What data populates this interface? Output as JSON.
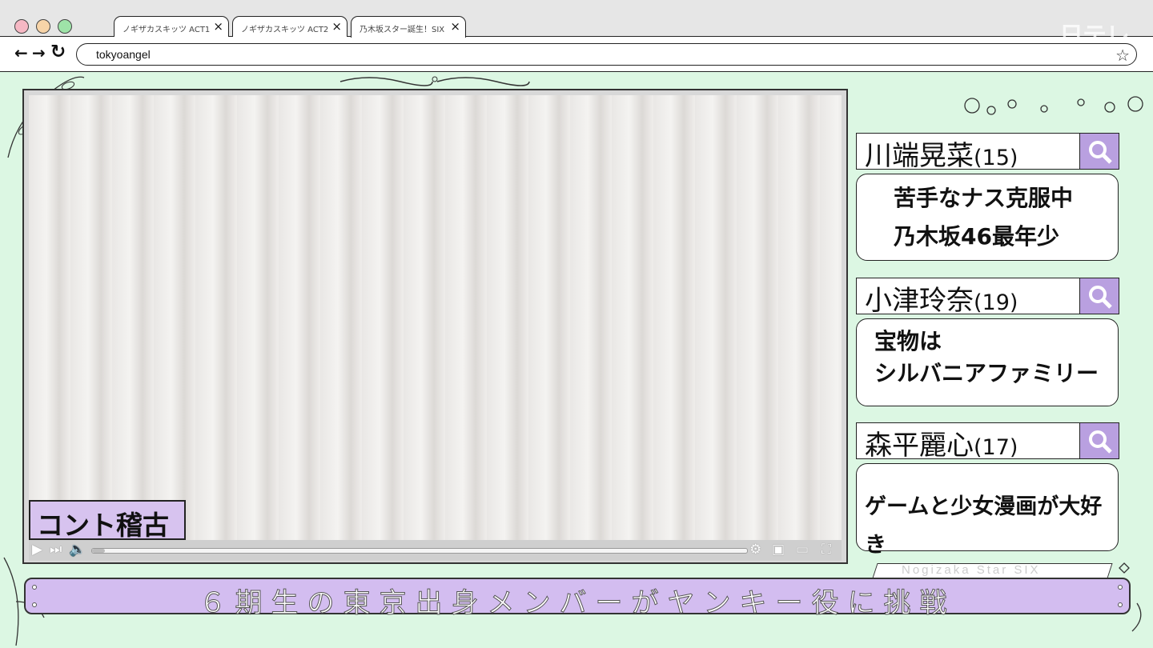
{
  "browser": {
    "tabs": [
      {
        "label": "ノギザカスキッツ ACT1"
      },
      {
        "label": "ノギザカスキッツ ACT2"
      },
      {
        "label": "乃木坂スター誕生！SIX"
      }
    ],
    "address": "tokyoangel",
    "watermark": "日テレ"
  },
  "video": {
    "caption": "コント稽古",
    "progress": 0.02
  },
  "members": [
    {
      "name": "川端晃菜",
      "age": "(15)",
      "lines": [
        "苦手なナス克服中",
        "乃木坂46最年少"
      ]
    },
    {
      "name": "小津玲奈",
      "age": "(19)",
      "lines": [
        "宝物は",
        "シルバニアファミリー"
      ]
    },
    {
      "name": "森平麗心",
      "age": "(17)",
      "lines": [
        "ゲームと少女漫画が大好き"
      ]
    }
  ],
  "banner": {
    "tag": "Nogizaka Star SIX",
    "text": "６期生の東京出身メンバーがヤンキー役に挑戦"
  },
  "colors": {
    "background": "#dcf7e3",
    "accent_purple": "#b9a0e0",
    "banner_purple": "#d3bdf0"
  }
}
